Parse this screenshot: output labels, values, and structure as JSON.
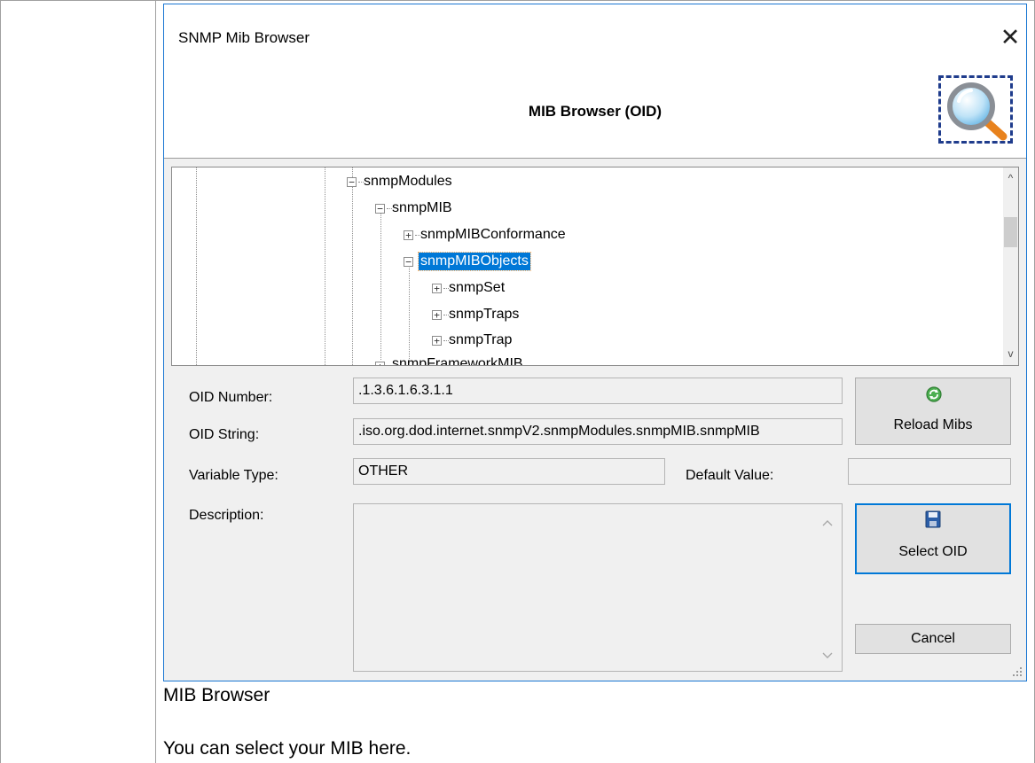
{
  "page": {
    "caption": "MIB Browser",
    "description": "You can select your MIB here."
  },
  "dialog": {
    "title": "SNMP Mib Browser",
    "close_glyph": "✕",
    "header_title": "MIB Browser (OID)",
    "header_icon": "magnifier-icon",
    "tree": {
      "nodes": [
        {
          "label": "snmpModules",
          "expander": "−",
          "level": 0
        },
        {
          "label": "snmpMIB",
          "expander": "−",
          "level": 1
        },
        {
          "label": "snmpMIBConformance",
          "expander": "+",
          "level": 2
        },
        {
          "label": "snmpMIBObjects",
          "expander": "−",
          "level": 2,
          "selected": true
        },
        {
          "label": "snmpSet",
          "expander": "+",
          "level": 3
        },
        {
          "label": "snmpTraps",
          "expander": "+",
          "level": 3
        },
        {
          "label": "snmpTrap",
          "expander": "+",
          "level": 3
        },
        {
          "label": "snmpFrameworkMIB",
          "expander": "+",
          "level": 1
        }
      ],
      "scroll_up": "^",
      "scroll_down": "v"
    },
    "form": {
      "oid_number_label": "OID Number:",
      "oid_number_value": ".1.3.6.1.6.3.1.1",
      "oid_string_label": "OID String:",
      "oid_string_value": ".iso.org.dod.internet.snmpV2.snmpModules.snmpMIB.snmpMIB",
      "variable_type_label": "Variable Type:",
      "variable_type_value": "OTHER",
      "default_value_label": "Default Value:",
      "default_value_value": "",
      "description_label": "Description:",
      "description_value": ""
    },
    "buttons": {
      "reload": "Reload Mibs",
      "reload_icon": "recycle-icon",
      "select": "Select OID",
      "select_icon": "floppy-disk-icon",
      "cancel": "Cancel"
    },
    "colors": {
      "accent": "#0078d7",
      "border": "#1976d2"
    }
  }
}
